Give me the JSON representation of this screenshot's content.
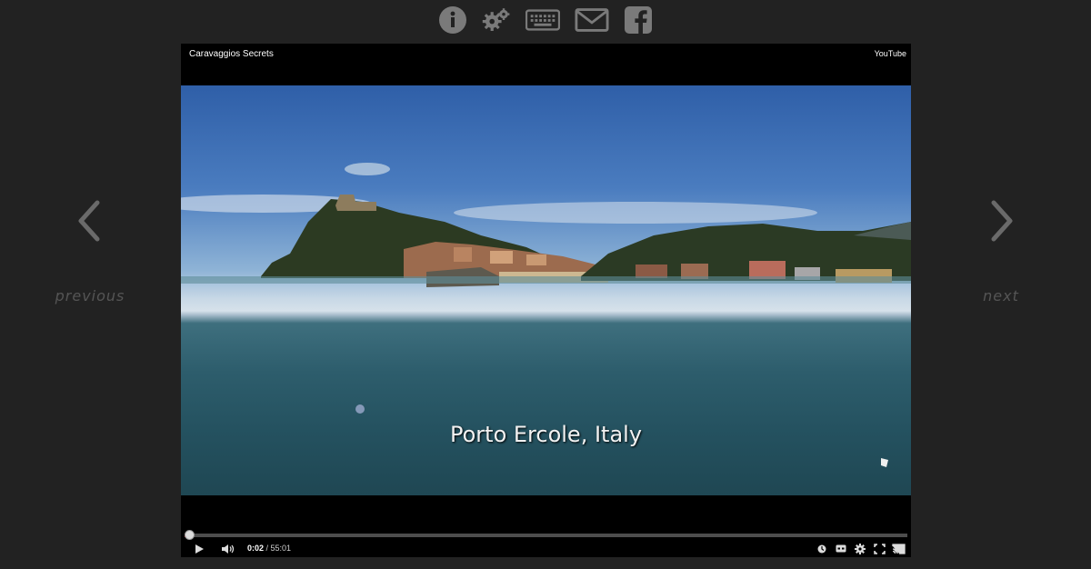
{
  "toolbar": {
    "icons": [
      "info-icon",
      "settings-icon",
      "keyboard-icon",
      "mail-icon",
      "facebook-icon"
    ]
  },
  "nav": {
    "previous_label": "previous",
    "next_label": "next"
  },
  "player": {
    "title": "Caravaggios Secrets",
    "brand": "YouTube",
    "subtitle": "Porto Ercole, Italy",
    "current_time": "0:02",
    "separator": " / ",
    "duration": "55:01",
    "progress_fraction": 0.0006
  },
  "colors": {
    "background": "#222222",
    "player_background": "#000000",
    "progress_played": "#cc181e"
  }
}
